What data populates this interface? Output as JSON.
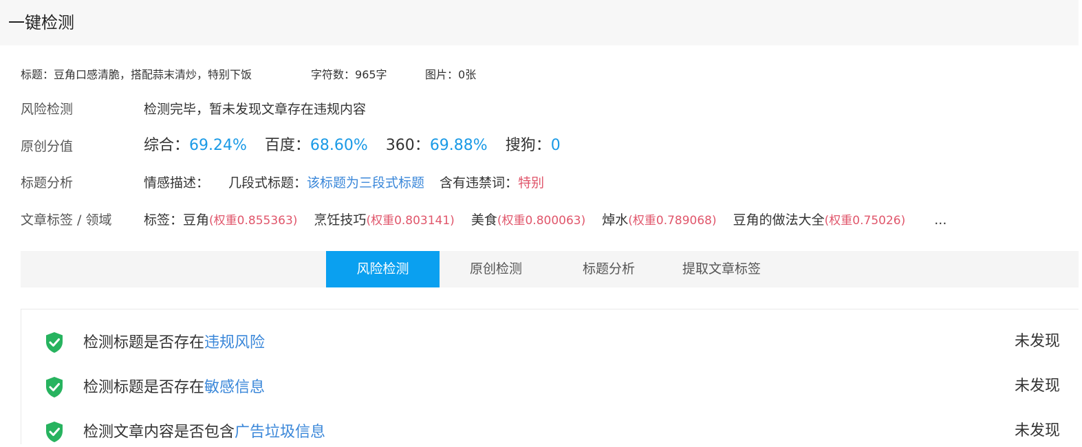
{
  "header": {
    "title": "一键检测"
  },
  "meta": {
    "title_label": "标题：",
    "title_value": "豆角口感清脆，搭配蒜末清炒，特别下饭",
    "chars_label": "字符数：",
    "chars_value": "965字",
    "images_label": "图片：",
    "images_value": "0张"
  },
  "risk": {
    "label": "风险检测",
    "text": "检测完毕，暂未发现文章存在违规内容"
  },
  "originality": {
    "label": "原创分值",
    "scores": [
      {
        "name": "综合：",
        "value": "69.24%"
      },
      {
        "name": "百度：",
        "value": "68.60%"
      },
      {
        "name": "360：",
        "value": "69.88%"
      },
      {
        "name": "搜狗：",
        "value": "0"
      }
    ]
  },
  "title_analysis": {
    "label": "标题分析",
    "emotion_label": "情感描述：",
    "segment_label": "几段式标题：",
    "segment_value": "该标题为三段式标题",
    "banned_label": "含有违禁词：",
    "banned_value": "特别"
  },
  "tags": {
    "label": "文章标签 / 领域",
    "prefix": "标签：",
    "items": [
      {
        "name": "豆角",
        "weight": "(权重0.855363)"
      },
      {
        "name": "烹饪技巧",
        "weight": "(权重0.803141)"
      },
      {
        "name": "美食",
        "weight": "(权重0.800063)"
      },
      {
        "name": "焯水",
        "weight": "(权重0.789068)"
      },
      {
        "name": "豆角的做法大全",
        "weight": "(权重0.75026)"
      }
    ],
    "more": "..."
  },
  "tabs": [
    {
      "label": "风险检测",
      "active": true
    },
    {
      "label": "原创检测",
      "active": false
    },
    {
      "label": "标题分析",
      "active": false
    },
    {
      "label": "提取文章标签",
      "active": false
    }
  ],
  "checks": [
    {
      "prefix": "检测标题是否存在",
      "highlight": "违规风险",
      "status": "未发现"
    },
    {
      "prefix": "检测标题是否存在",
      "highlight": "敏感信息",
      "status": "未发现"
    },
    {
      "prefix": "检测文章内容是否包含",
      "highlight": "广告垃圾信息",
      "status": "未发现"
    }
  ],
  "colors": {
    "accent": "#0aa0f0",
    "score": "#1a9ae6",
    "link": "#3a87d9",
    "warning": "#e0566b",
    "shield": "#27b35f"
  },
  "icons": {
    "check": "shield-check-icon"
  }
}
